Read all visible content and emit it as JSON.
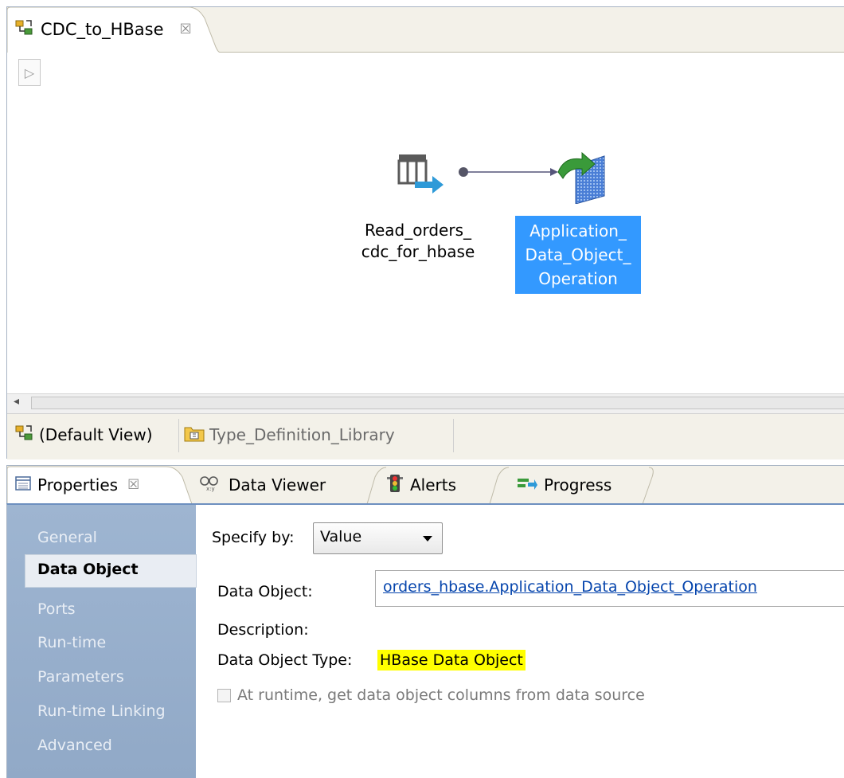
{
  "editor": {
    "tab_title": "CDC_to_HBase",
    "tab_close": "☒",
    "run_symbol": "▷",
    "nodes": {
      "read": {
        "label_line1": "Read_orders_",
        "label_line2": "cdc_for_hbase"
      },
      "write": {
        "label_line1": "Application_",
        "label_line2": "Data_Object_",
        "label_line3": "Operation"
      }
    },
    "scroll_arrow": "◂",
    "view_tabs": {
      "default": "(Default View)",
      "type_library": "Type_Definition_Library"
    }
  },
  "panel": {
    "tabs": {
      "properties": "Properties",
      "properties_close": "☒",
      "data_viewer": "Data Viewer",
      "alerts": "Alerts",
      "progress": "Progress"
    },
    "nav": {
      "general": "General",
      "data_object": "Data Object",
      "ports": "Ports",
      "runtime": "Run-time",
      "parameters": "Parameters",
      "runtime_linking": "Run-time Linking",
      "advanced": "Advanced"
    },
    "content": {
      "specify_label": "Specify by:",
      "specify_value": "Value",
      "data_object_label": "Data Object:",
      "data_object_value": "orders_hbase.Application_Data_Object_Operation",
      "description_label": "Description:",
      "type_label": "Data Object Type:",
      "type_value": "HBase Data Object",
      "runtime_checkbox_label": "At runtime, get data object columns from data source"
    }
  },
  "colors": {
    "selection": "#3399ff",
    "highlight": "#ffff00",
    "link": "#0645ad",
    "nav_bg": "#9eb5d1"
  }
}
